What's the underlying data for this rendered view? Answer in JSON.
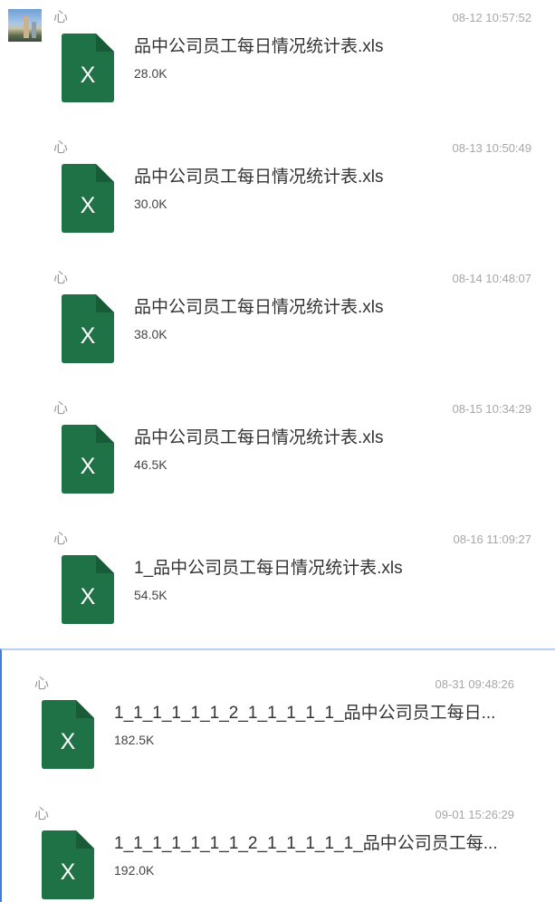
{
  "colors": {
    "excel_green": "#1f7246",
    "excel_fold": "#185c37",
    "timestamp": "#a7a7a7",
    "divider": "#3f7ed8"
  },
  "top_messages": [
    {
      "sender": "心",
      "time": "08-12 10:57:52",
      "file_name": "品中公司员工每日情况统计表.xls",
      "file_size": "28.0K",
      "icon": "excel-file-icon",
      "icon_letter": "X"
    },
    {
      "sender": "心",
      "time": "08-13 10:50:49",
      "file_name": "品中公司员工每日情况统计表.xls",
      "file_size": "30.0K",
      "icon": "excel-file-icon",
      "icon_letter": "X"
    },
    {
      "sender": "心",
      "time": "08-14 10:48:07",
      "file_name": "品中公司员工每日情况统计表.xls",
      "file_size": "38.0K",
      "icon": "excel-file-icon",
      "icon_letter": "X"
    },
    {
      "sender": "心",
      "time": "08-15 10:34:29",
      "file_name": "品中公司员工每日情况统计表.xls",
      "file_size": "46.5K",
      "icon": "excel-file-icon",
      "icon_letter": "X"
    },
    {
      "sender": "心",
      "time": "08-16 11:09:27",
      "file_name": "1_品中公司员工每日情况统计表.xls",
      "file_size": "54.5K",
      "icon": "excel-file-icon",
      "icon_letter": "X"
    }
  ],
  "bottom_messages": [
    {
      "sender": "心",
      "time": "08-31 09:48:26",
      "file_name": "1_1_1_1_1_1_2_1_1_1_1_1_品中公司员工每日...",
      "file_size": "182.5K",
      "icon": "excel-file-icon",
      "icon_letter": "X"
    },
    {
      "sender": "心",
      "time": "09-01 15:26:29",
      "file_name": "1_1_1_1_1_1_1_2_1_1_1_1_1_品中公司员工每...",
      "file_size": "192.0K",
      "icon": "excel-file-icon",
      "icon_letter": "X"
    }
  ]
}
